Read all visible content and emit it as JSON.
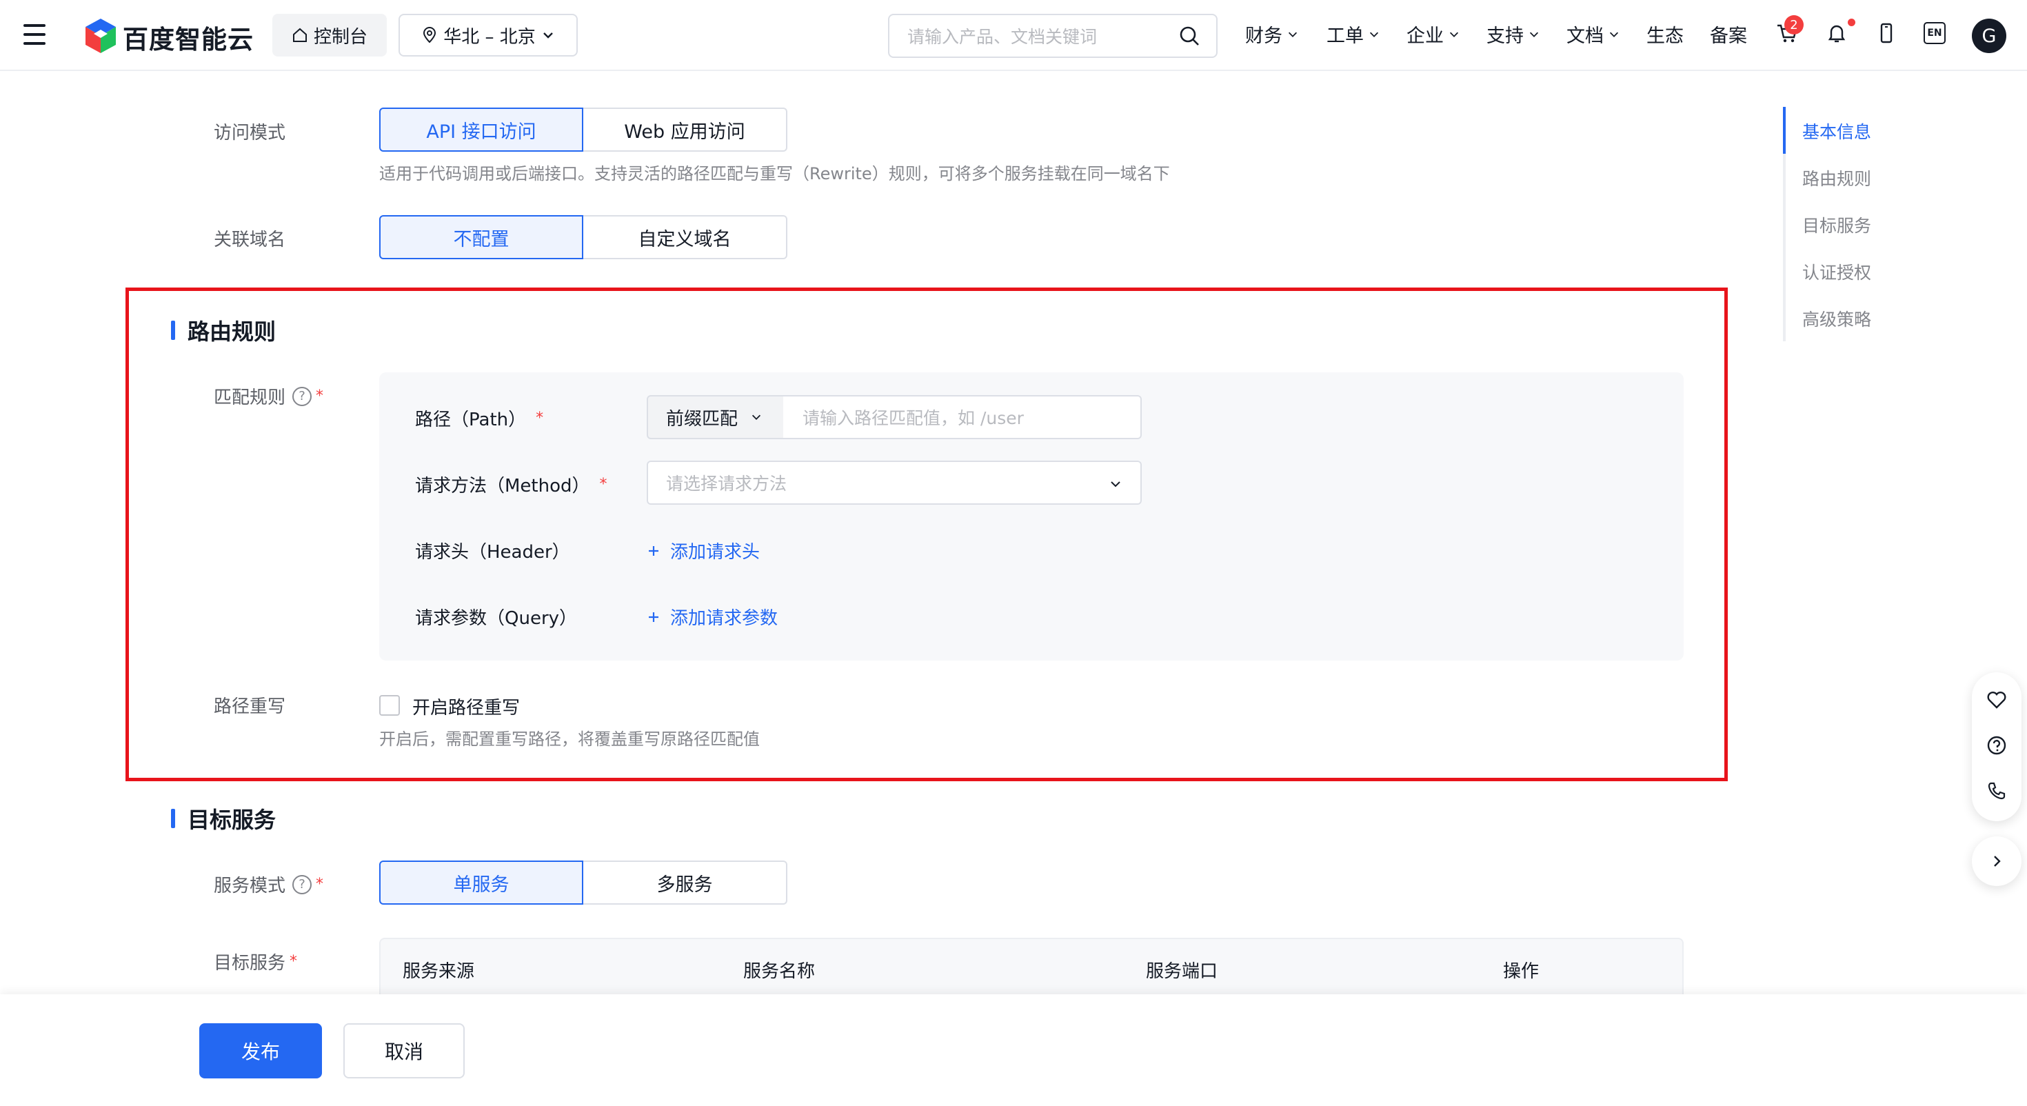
{
  "header": {
    "logo_text": "百度智能云",
    "console_label": "控制台",
    "region_label": "华北 – 北京",
    "search_placeholder": "请输入产品、文档关键词",
    "nav": [
      {
        "label": "财务",
        "dropdown": true
      },
      {
        "label": "工单",
        "dropdown": true
      },
      {
        "label": "企业",
        "dropdown": true
      },
      {
        "label": "支持",
        "dropdown": true
      },
      {
        "label": "文档",
        "dropdown": true
      },
      {
        "label": "生态",
        "dropdown": false
      },
      {
        "label": "备案",
        "dropdown": false
      }
    ],
    "cart_badge": "2",
    "lang_label": "EN",
    "avatar_letter": "G"
  },
  "form": {
    "access_mode": {
      "label": "访问模式",
      "options": [
        "API 接口访问",
        "Web 应用访问"
      ],
      "selected": "API 接口访问",
      "hint": "适用于代码调用或后端接口。支持灵活的路径匹配与重写（Rewrite）规则，可将多个服务挂载在同一域名下"
    },
    "domain": {
      "label": "关联域名",
      "options": [
        "不配置",
        "自定义域名"
      ],
      "selected": "不配置"
    },
    "routing": {
      "title": "路由规则",
      "match_label": "匹配规则",
      "path_label": "路径（Path）",
      "path_match_type": "前缀匹配",
      "path_placeholder": "请输入路径匹配值，如 /user",
      "method_label": "请求方法（Method）",
      "method_placeholder": "请选择请求方法",
      "header_label": "请求头（Header）",
      "add_header": "添加请求头",
      "query_label": "请求参数（Query）",
      "add_query": "添加请求参数",
      "rewrite_label": "路径重写",
      "rewrite_checkbox": "开启路径重写",
      "rewrite_checked": false,
      "rewrite_hint": "开启后，需配置重写路径，将覆盖重写原路径匹配值"
    },
    "target": {
      "title": "目标服务",
      "mode_label": "服务模式",
      "mode_options": [
        "单服务",
        "多服务"
      ],
      "mode_selected": "单服务",
      "service_label": "目标服务",
      "columns": [
        "服务来源",
        "服务名称",
        "服务端口",
        "操作"
      ]
    }
  },
  "toc": {
    "items": [
      "基本信息",
      "路由规则",
      "目标服务",
      "认证授权",
      "高级策略"
    ],
    "active": "基本信息"
  },
  "footer": {
    "publish_label": "发布",
    "cancel_label": "取消"
  },
  "colors": {
    "accent": "#2468f2",
    "highlight_box": "#e8141b",
    "required": "#f33e3e"
  }
}
